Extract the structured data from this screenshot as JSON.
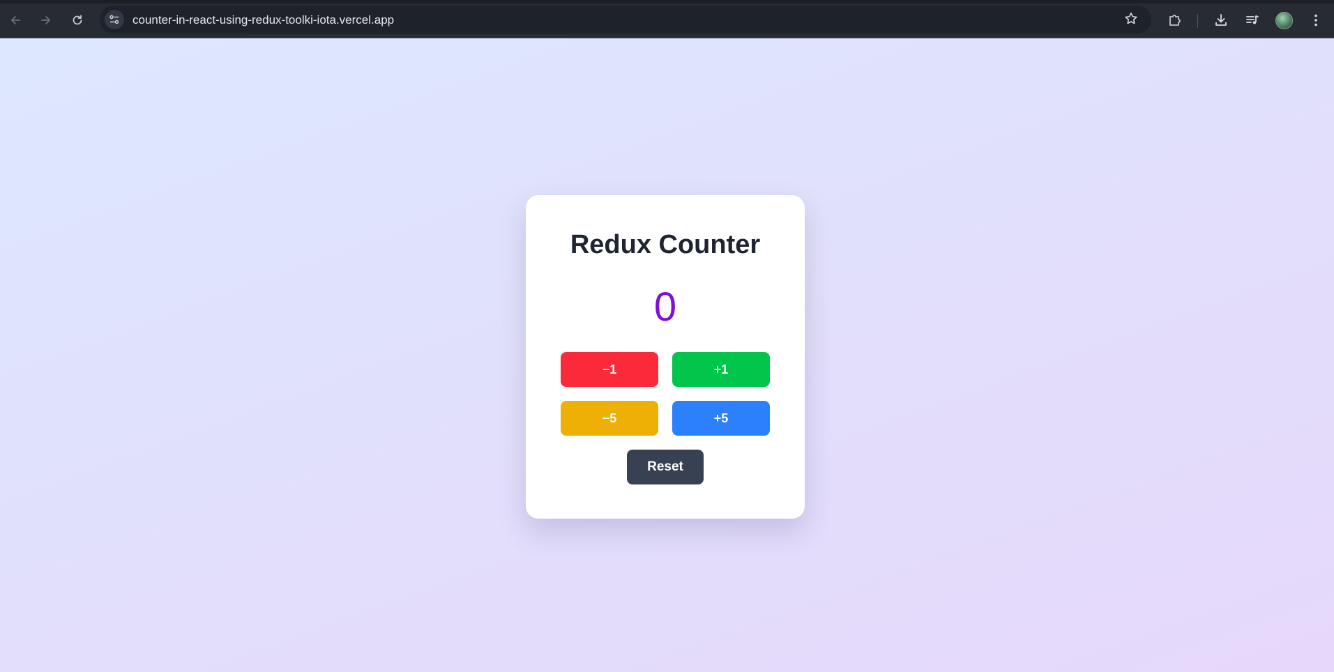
{
  "browser": {
    "url": "counter-in-react-using-redux-toolki-iota.vercel.app",
    "icons": {
      "back": "arrow-left-icon",
      "forward": "arrow-right-icon",
      "reload": "reload-icon",
      "site_info": "tune-icon",
      "bookmark": "star-icon",
      "extensions": "puzzle-icon",
      "downloads": "download-icon",
      "media": "media-queue-icon",
      "menu": "kebab-menu-icon"
    }
  },
  "app": {
    "title": "Redux Counter",
    "count": "0",
    "buttons": {
      "minus_one": "−1",
      "plus_one": "+1",
      "minus_five": "−5",
      "plus_five": "+5",
      "reset": "Reset"
    }
  },
  "colors": {
    "count": "#7e10d8",
    "minus_one": "#fa2a3a",
    "plus_one": "#02c54c",
    "minus_five": "#eeb005",
    "plus_five": "#2c80fb",
    "reset": "#384152"
  }
}
